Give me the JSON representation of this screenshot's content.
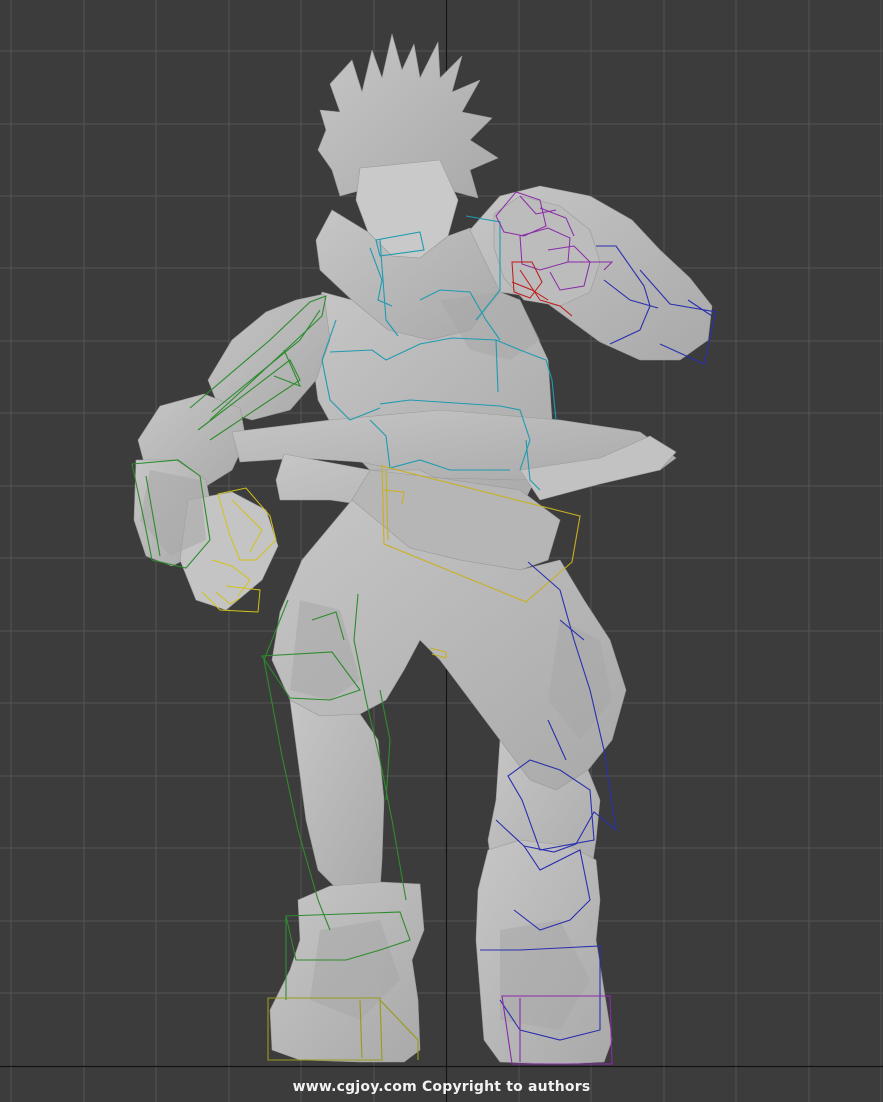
{
  "viewport": {
    "background_color": "#3c3c3c",
    "grid_color": "#555555",
    "axis_color": "#111111",
    "model_color": "#bdbdbd",
    "bone_colors": {
      "spine": "#1f9bb0",
      "left_arm": "#2e8b2e",
      "right_arm": "#2a2fae",
      "left_hand": "#d2c21a",
      "right_hand": "#8a2aa8",
      "right_finger": "#c01818",
      "pelvis": "#c9b020",
      "foot_left": "#9a9a1a",
      "foot_right": "#8a2aa8"
    }
  },
  "watermark": {
    "text": "www.cgjoy.com Copyright to authors"
  }
}
